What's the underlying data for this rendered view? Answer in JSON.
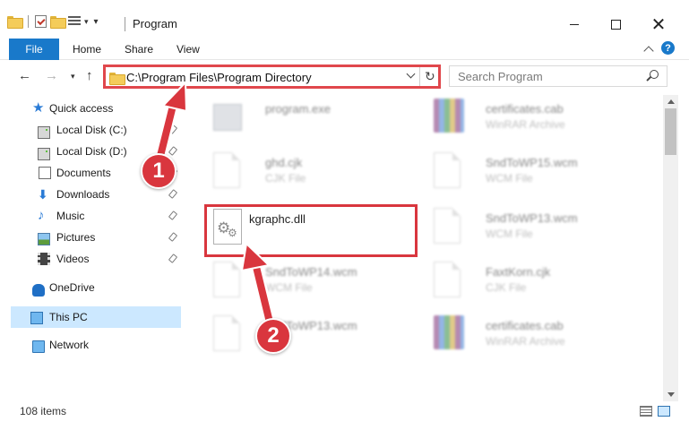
{
  "window": {
    "title": "Program",
    "close_glyph": "✕"
  },
  "ribbon": {
    "file": "File",
    "home": "Home",
    "share": "Share",
    "view": "View",
    "help": "?"
  },
  "nav": {
    "back": "←",
    "forward": "→",
    "recent": "▾",
    "up": "↑",
    "refresh": "↻"
  },
  "address": {
    "path": "C:\\Program Files\\Program Directory"
  },
  "search": {
    "placeholder": "Search Program"
  },
  "sidebar": {
    "items": [
      {
        "label": "Quick access",
        "icon": "star-icon"
      },
      {
        "label": "Local Disk (C:)",
        "icon": "drive-icon",
        "pinned": true
      },
      {
        "label": "Local Disk (D:)",
        "icon": "drive-icon",
        "pinned": true
      },
      {
        "label": "Documents",
        "icon": "documents-icon",
        "pinned": true
      },
      {
        "label": "Downloads",
        "icon": "download-icon",
        "pinned": true
      },
      {
        "label": "Music",
        "icon": "music-icon",
        "pinned": true
      },
      {
        "label": "Pictures",
        "icon": "pictures-icon",
        "pinned": true
      },
      {
        "label": "Videos",
        "icon": "videos-icon",
        "pinned": true
      },
      {
        "label": "OneDrive",
        "icon": "cloud-icon"
      },
      {
        "label": "This PC",
        "icon": "computer-icon",
        "selected": true
      },
      {
        "label": "Network",
        "icon": "network-icon"
      }
    ]
  },
  "files": [
    {
      "name": "program.exe",
      "type": "",
      "icon": "exe-icon",
      "blurred": true
    },
    {
      "name": "certificates.cab",
      "type": "WinRAR Archive",
      "icon": "winrar-icon",
      "blurred": true
    },
    {
      "name": "ghd.cjk",
      "type": "CJK File",
      "icon": "file-icon",
      "blurred": true
    },
    {
      "name": "SndToWP15.wcm",
      "type": "WCM File",
      "icon": "file-icon",
      "blurred": true
    },
    {
      "name": "kgraphc.dll",
      "type": "",
      "icon": "dll-gear-icon",
      "blurred": false
    },
    {
      "name": "SndToWP13.wcm",
      "type": "WCM File",
      "icon": "file-icon",
      "blurred": true
    },
    {
      "name": "SndToWP14.wcm",
      "type": "WCM File",
      "icon": "file-icon",
      "blurred": true
    },
    {
      "name": "FaxtKorn.cjk",
      "type": "CJK File",
      "icon": "file-icon",
      "blurred": true
    },
    {
      "name": "SndToWP13.wcm",
      "type": "",
      "icon": "file-icon",
      "blurred": true
    },
    {
      "name": "certificates.cab",
      "type": "WinRAR Archive",
      "icon": "winrar-icon",
      "blurred": true
    }
  ],
  "annotations": {
    "step1": "1",
    "step2": "2",
    "color": "#d9363e"
  },
  "status": {
    "item_count": "108 items"
  },
  "colors": {
    "accent": "#1979ca",
    "highlight": "#e0474c",
    "selection": "#cce8ff"
  }
}
